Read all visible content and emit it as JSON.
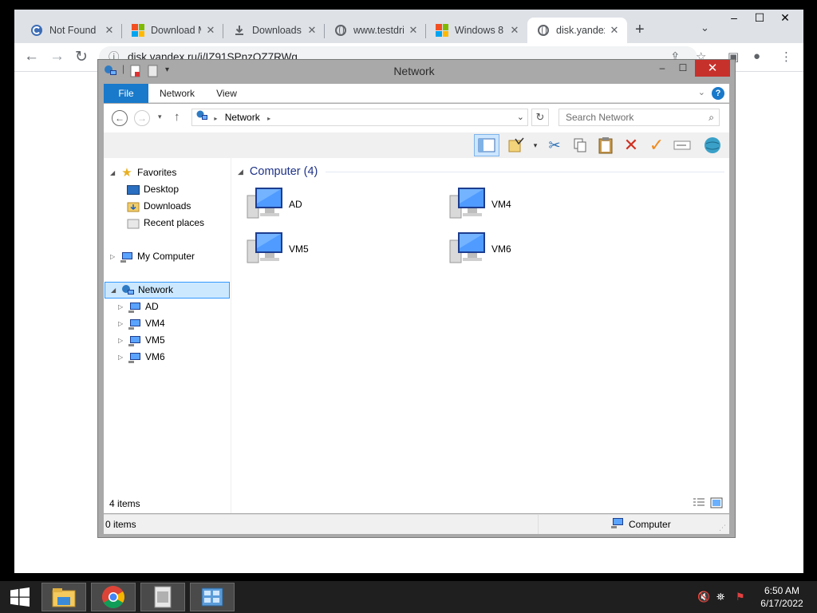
{
  "browser": {
    "tabs": [
      {
        "label": "Not Found",
        "icon": "c-logo-icon"
      },
      {
        "label": "Download M",
        "icon": "microsoft-logo-icon"
      },
      {
        "label": "Downloads",
        "icon": "download-icon"
      },
      {
        "label": "www.testdri",
        "icon": "globe-icon"
      },
      {
        "label": "Windows 8 ",
        "icon": "microsoft-logo-icon"
      },
      {
        "label": "disk.yandex",
        "icon": "globe-icon"
      }
    ],
    "url": "disk.yandex.ru/i/IZ91SPnzOZ7RWg"
  },
  "explorer": {
    "title": "Network",
    "ribbon_tabs": [
      "File",
      "Network",
      "View"
    ],
    "help": "?",
    "address": {
      "root": "Network"
    },
    "search_placeholder": "Search Network",
    "navpane": {
      "favorites": "Favorites",
      "desktop": "Desktop",
      "downloads": "Downloads",
      "recent": "Recent places",
      "my_computer": "My Computer",
      "network": "Network",
      "computers": [
        "AD",
        "VM4",
        "VM5",
        "VM6"
      ]
    },
    "group_header": "Computer (4)",
    "items": [
      "AD",
      "VM4",
      "VM5",
      "VM6"
    ],
    "status_count": "4 items",
    "status_selected": "0 items",
    "status_location": "Computer"
  },
  "taskbar": {
    "time": "6:50 AM",
    "date": "6/17/2022"
  },
  "colors": {
    "accent": "#1979ca",
    "close_red": "#c7312b",
    "selection": "#cce8ff"
  }
}
